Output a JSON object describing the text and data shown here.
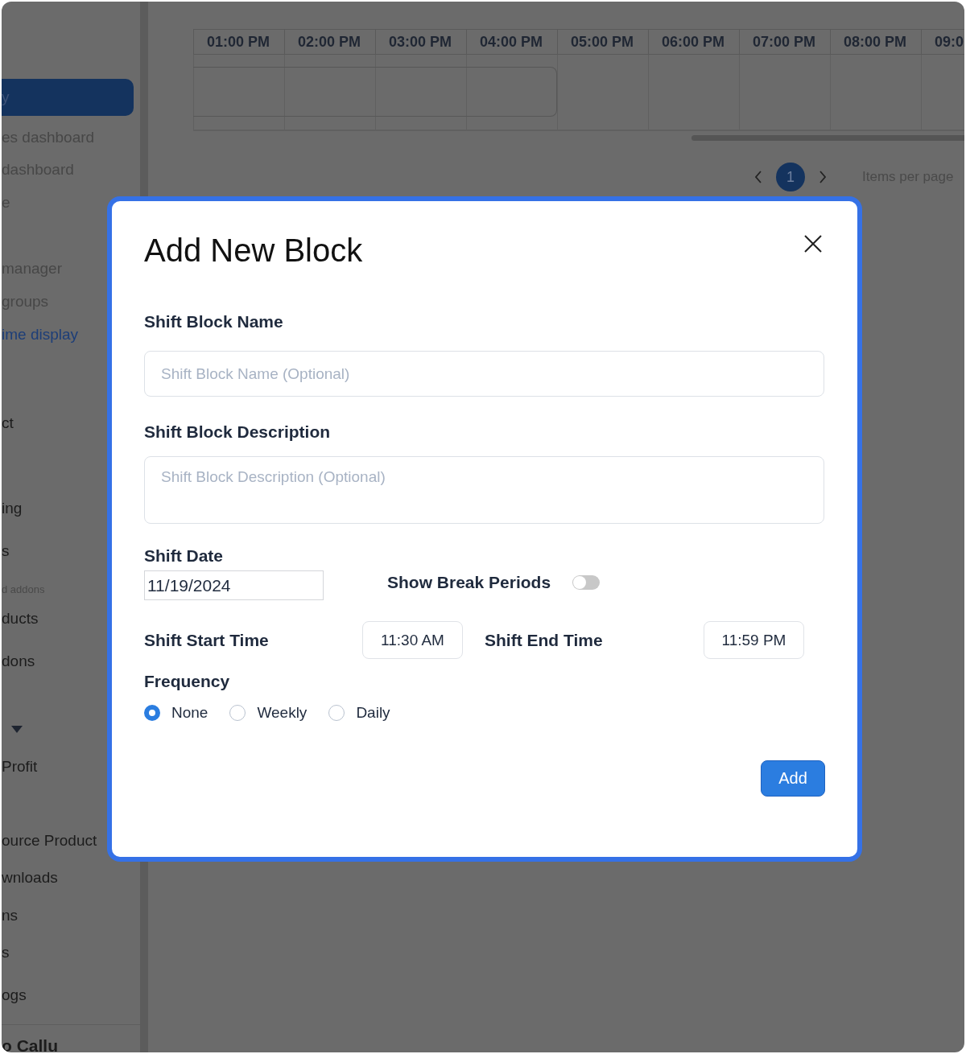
{
  "sidebar": {
    "items": [
      {
        "kind": "muted",
        "label": "y",
        "selected": true
      },
      {
        "kind": "muted",
        "label": "es dashboard",
        "selected": false
      },
      {
        "kind": "muted",
        "label": "dashboard",
        "selected": false
      },
      {
        "kind": "muted",
        "label": "e",
        "selected": false
      },
      {
        "kind": "muted",
        "label": "manager",
        "selected": false
      },
      {
        "kind": "muted",
        "label": "groups",
        "selected": false
      },
      {
        "kind": "link",
        "label": "ime display",
        "selected": false
      },
      {
        "kind": "plain",
        "label": "ct",
        "selected": false
      },
      {
        "kind": "plain",
        "label": "ing",
        "selected": false
      },
      {
        "kind": "plain",
        "label": "s",
        "selected": false
      },
      {
        "kind": "caption",
        "label": "d addons"
      },
      {
        "kind": "plain",
        "label": "ducts",
        "selected": false
      },
      {
        "kind": "plain",
        "label": "dons",
        "selected": false
      },
      {
        "kind": "caret"
      },
      {
        "kind": "plain",
        "label": "Profit",
        "selected": false
      },
      {
        "kind": "plain",
        "label": "ource Product",
        "selected": false
      },
      {
        "kind": "plain",
        "label": "wnloads",
        "selected": false
      },
      {
        "kind": "plain",
        "label": "ns",
        "selected": false
      },
      {
        "kind": "plain",
        "label": "s",
        "selected": false
      },
      {
        "kind": "plain",
        "label": "ogs",
        "selected": false
      },
      {
        "kind": "footer",
        "label": "o Callu"
      }
    ]
  },
  "schedule": {
    "columns": [
      "01:00 PM",
      "02:00 PM",
      "03:00 PM",
      "04:00 PM",
      "05:00 PM",
      "06:00 PM",
      "07:00 PM",
      "08:00 PM",
      "09:0"
    ],
    "pagination": {
      "pages": [
        {
          "label": "1",
          "selected": true
        }
      ],
      "items_per_page_label": "Items per page"
    }
  },
  "dialog": {
    "title": "Add New Block",
    "fields": [
      {
        "kind": "input",
        "label": "Shift Block Name",
        "placeholder": "Shift Block Name (Optional)"
      },
      {
        "kind": "textarea",
        "label": "Shift Block Description",
        "placeholder": "Shift Block Description (Optional)"
      }
    ],
    "shift_date": {
      "label": "Shift Date",
      "value": "11/19/2024"
    },
    "break_toggle": {
      "label": "Show Break Periods",
      "on": false
    },
    "start_time": {
      "label": "Shift Start Time",
      "value": "11:30 AM"
    },
    "end_time": {
      "label": "Shift End Time",
      "value": "11:59 PM"
    },
    "frequency": {
      "label": "Frequency",
      "options": [
        {
          "label": "None",
          "selected": true
        },
        {
          "label": "Weekly",
          "selected": false
        },
        {
          "label": "Daily",
          "selected": false
        }
      ]
    },
    "add_button": "Add"
  }
}
